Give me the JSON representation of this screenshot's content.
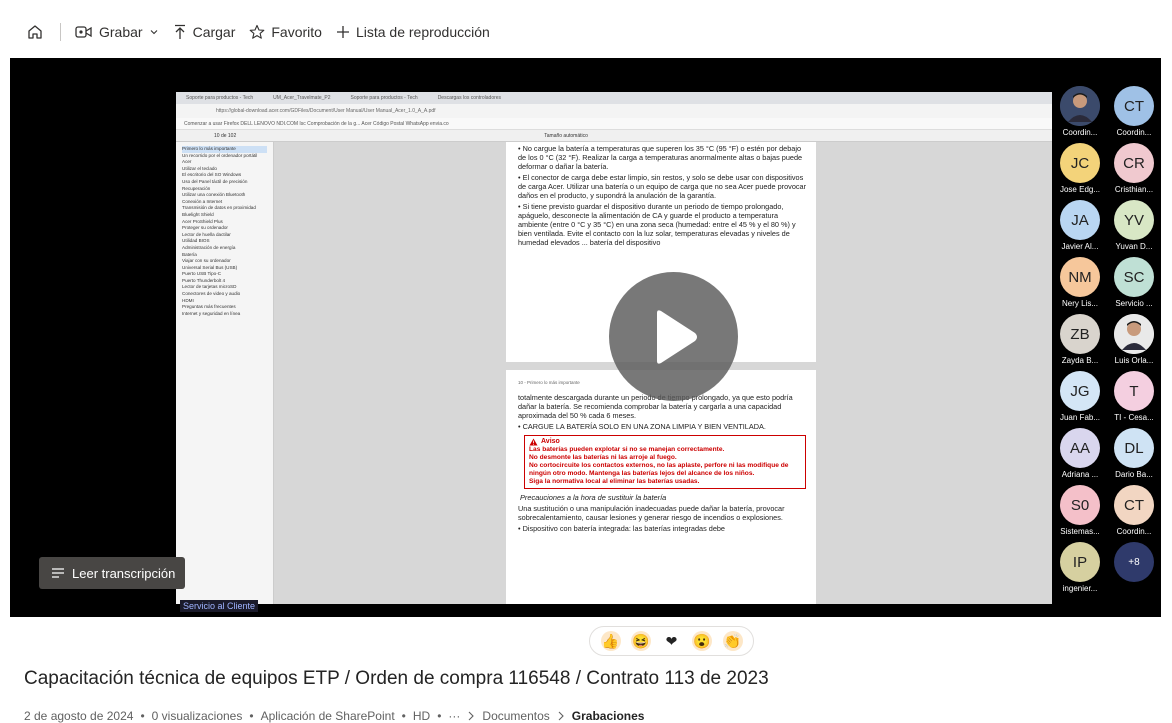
{
  "toolbar": {
    "record": "Grabar",
    "upload": "Cargar",
    "favorite": "Favorito",
    "playlist": "Lista de reproducción"
  },
  "shared_screen": {
    "browser_tabs": [
      "Soporte para productos - Tech",
      "UM_Acer_Travelmate_P2",
      "Soporte para productos - Tech",
      "Descargas los controladores"
    ],
    "address": "https://global-download.acer.com/GDFiles/Document/User Manual/User Manual_Acer_1.0_A_A.pdf",
    "bookmarks": "Comenzar a usar Firefox   DELL   LENOVO   NDI.COM   Isc   Comprobación de la g...   Acer   Código Postal   WhatsApp   envia.co",
    "page_indicator": "10 de 102",
    "zoom": "Tamaño automático",
    "sidebar": [
      "Primero lo más importante",
      "Un recorrido por el ordenador portátil Acer",
      "Utilizar el teclado",
      "El escritorio del SO Windows",
      "Uso del Panel táctil de precisión",
      "Recuperación",
      "Utilizar una conexión Bluetooth",
      "Conexión a Internet",
      "Transmisión de datos en proximidad",
      "Bluelight Shield",
      "Acer ProShield Plus",
      "Proteger su ordenador",
      "Lector de huella dactilar",
      "Utilidad BIOS",
      "Administración de energía",
      "Batería",
      "Viajar con su ordenador",
      "Universal Serial Bus (USB)",
      "Puerto USB Tipo-C",
      "Puerto Thunderbolt 4",
      "Lector de tarjetas microSD",
      "Conectores de video y audio",
      "HDMI",
      "Preguntas más frecuentes",
      "Internet y seguridad en línea"
    ],
    "page1": [
      "• No cargue la batería a temperaturas que superen los 35 °C (95 °F) o estén por debajo de los 0 °C (32 °F). Realizar la carga a temperaturas anormalmente altas o bajas puede deformar o dañar la batería.",
      "• El conector de carga debe estar limpio, sin restos, y solo se debe usar con dispositivos de carga Acer. Utilizar una batería o un equipo de carga que no sea Acer puede provocar daños en el producto, y supondrá la anulación de la garantía.",
      "• Si tiene previsto guardar el dispositivo durante un periodo de tiempo prolongado, apáguelo, desconecte la alimentación de CA y guarde el producto a temperatura ambiente (entre 0 °C y 35 °C) en una zona seca (humedad: entre el 45 % y el 80 %) y bien ventilada. Evite el contacto con la luz solar, temperaturas elevadas y niveles de humedad elevados ... batería del dispositivo"
    ],
    "page2_header": "10 - Primero lo más importante",
    "page2": [
      "totalmente descargada durante un periodo de tiempo prolongado, ya que esto podría dañar la batería. Se recomienda comprobar la batería y cargarla a una capacidad aproximada del 50 % cada 6 meses.",
      "• CARGUE LA BATERÍA SOLO EN UNA ZONA LIMPIA Y BIEN VENTILADA."
    ],
    "warning_title": "Aviso",
    "warning_lines": [
      "Las baterías pueden explotar si no se manejan correctamente.",
      "No desmonte las baterías ni las arroje al fuego.",
      "No cortocircuite los contactos externos, no las aplaste, perfore ni las modifique de ningún otro modo. Mantenga las baterías lejos del alcance de los niños.",
      "Siga la normativa local al eliminar las baterías usadas."
    ],
    "subheading": "Precauciones a la hora de sustituir la batería",
    "page2_after": [
      "Una sustitución o una manipulación inadecuadas puede dañar la batería, provocar sobrecalentamiento, causar lesiones y generar riesgo de incendios o explosiones.",
      "• Dispositivo con batería integrada: las baterías integradas debe"
    ]
  },
  "participants": [
    {
      "initials": "",
      "name": "Coordin...",
      "color": "#3b4a6b",
      "photo": true
    },
    {
      "initials": "CT",
      "name": "Coordin...",
      "color": "#9fc1e6"
    },
    {
      "initials": "JC",
      "name": "Jose Edg...",
      "color": "#f3d37a"
    },
    {
      "initials": "CR",
      "name": "Cristhian...",
      "color": "#f0c9cf"
    },
    {
      "initials": "JA",
      "name": "Javier Al...",
      "color": "#b9d6f2"
    },
    {
      "initials": "YV",
      "name": "Yuvan D...",
      "color": "#d8e7c5"
    },
    {
      "initials": "NM",
      "name": "Nery Lis...",
      "color": "#f6c79b"
    },
    {
      "initials": "SC",
      "name": "Servicio ...",
      "color": "#bfe0d5"
    },
    {
      "initials": "ZB",
      "name": "Zayda B...",
      "color": "#d9d4cd"
    },
    {
      "initials": "",
      "name": "Luis Orla...",
      "color": "#e9e9e9",
      "photo": true
    },
    {
      "initials": "JG",
      "name": "Juan Fab...",
      "color": "#d4e6f6"
    },
    {
      "initials": "T",
      "name": "TI - Cesa...",
      "color": "#f4cfe0"
    },
    {
      "initials": "AA",
      "name": "Adriana ...",
      "color": "#d9d6ee"
    },
    {
      "initials": "DL",
      "name": "Dario Ba...",
      "color": "#cfe3f4"
    },
    {
      "initials": "S0",
      "name": "Sistemas...",
      "color": "#f4c0c9"
    },
    {
      "initials": "CT",
      "name": "Coordin...",
      "color": "#f2d6c2"
    },
    {
      "initials": "IP",
      "name": "ingenier...",
      "color": "#d6d0a0"
    },
    {
      "initials": "+8",
      "name": "",
      "color": "#2f3a6b"
    }
  ],
  "transcript_button": "Leer transcripción",
  "speaker_label": "Servicio al Cliente",
  "reactions": [
    {
      "name": "thumbs-up",
      "glyph": "👍",
      "bg": "#fde7c7"
    },
    {
      "name": "laugh",
      "glyph": "😆",
      "bg": "#fde7c7"
    },
    {
      "name": "heart",
      "glyph": "❤",
      "bg": "#fff"
    },
    {
      "name": "surprised",
      "glyph": "😮",
      "bg": "#fde7c7"
    },
    {
      "name": "clap",
      "glyph": "👏",
      "bg": "#fde7c7"
    }
  ],
  "title": "Capacitación técnica de equipos ETP / Orden de compra 116548 / Contrato 113 de 2023",
  "meta": {
    "date": "2 de agosto de 2024",
    "views": "0 visualizaciones",
    "app": "Aplicación de SharePoint",
    "quality": "HD",
    "more": "···",
    "crumb1": "Documentos",
    "crumb2": "Grabaciones"
  }
}
